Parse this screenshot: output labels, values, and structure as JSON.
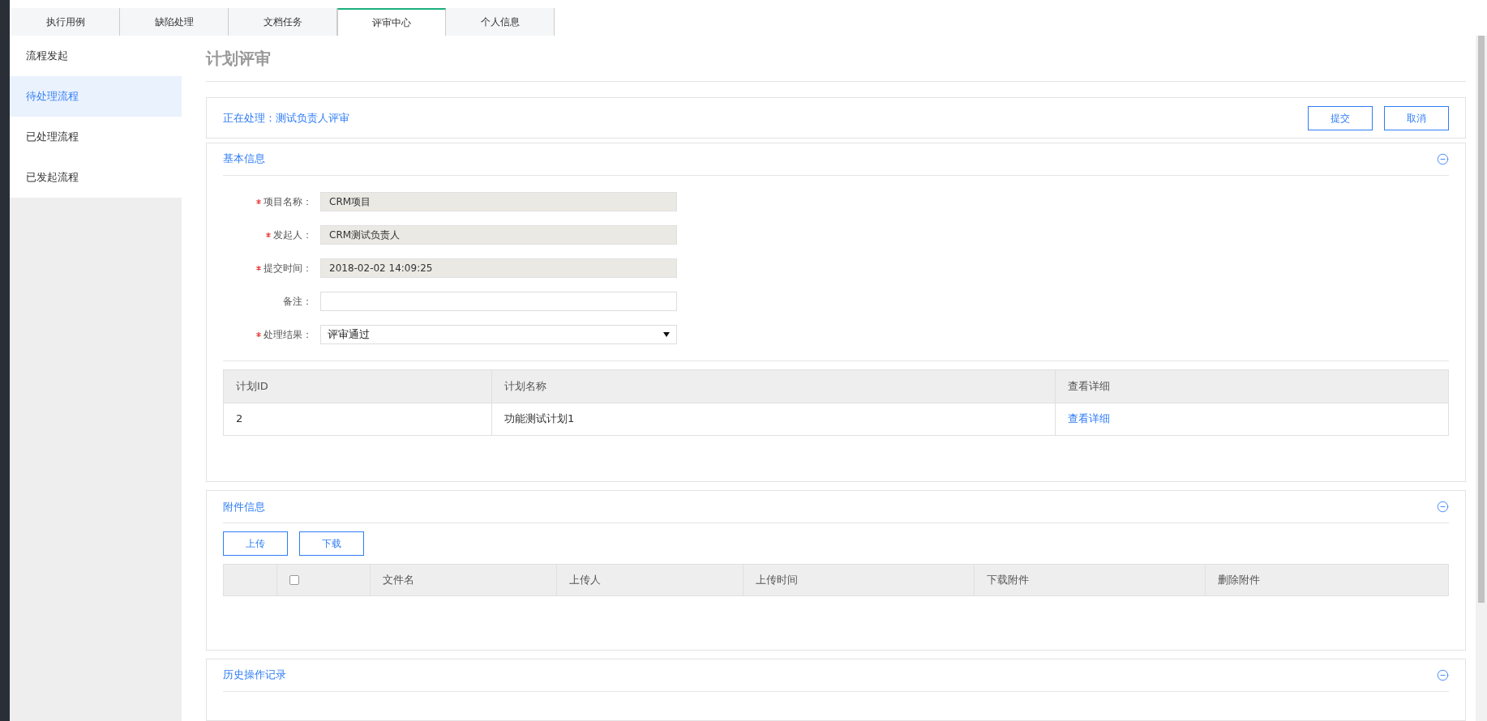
{
  "tabs": [
    {
      "label": "执行用例",
      "selected": false
    },
    {
      "label": "缺陷处理",
      "selected": false
    },
    {
      "label": "文档任务",
      "selected": false
    },
    {
      "label": "评审中心",
      "selected": true
    },
    {
      "label": "个人信息",
      "selected": false
    }
  ],
  "sidebar": {
    "items": [
      {
        "label": "流程发起",
        "selected": false
      },
      {
        "label": "待处理流程",
        "selected": true
      },
      {
        "label": "已处理流程",
        "selected": false
      },
      {
        "label": "已发起流程",
        "selected": false
      }
    ]
  },
  "page_title": "计划评审",
  "processing": {
    "label": "正在处理：测试负责人评审",
    "buttons": [
      "提交",
      "取消"
    ]
  },
  "basic_info": {
    "title": "基本信息",
    "expanded": true,
    "fields": [
      {
        "label": "项目名称：",
        "required": true,
        "kind": "readonly",
        "value": "CRM项目"
      },
      {
        "label": "发起人：",
        "required": true,
        "kind": "readonly",
        "value": "CRM测试负责人"
      },
      {
        "label": "提交时间：",
        "required": true,
        "kind": "readonly",
        "value": "2018-02-02 14:09:25"
      },
      {
        "label": "备注：",
        "required": false,
        "kind": "text"
      },
      {
        "label": "处理结果：",
        "required": true,
        "kind": "select",
        "value": "评审通过"
      }
    ],
    "plan_table": {
      "columns": [
        "计划ID",
        "计划名称",
        "查看详细"
      ],
      "rows": [
        {
          "id": "2",
          "name": "功能测试计划1",
          "link": "查看详细"
        }
      ]
    }
  },
  "attachments": {
    "title": "附件信息",
    "expanded": true,
    "buttons": [
      "上传",
      "下载"
    ],
    "select_all_checked": false,
    "columns": [
      "文件名",
      "上传人",
      "上传时间",
      "下载附件",
      "删除附件"
    ]
  },
  "history": {
    "title": "历史操作记录",
    "expanded": true
  }
}
